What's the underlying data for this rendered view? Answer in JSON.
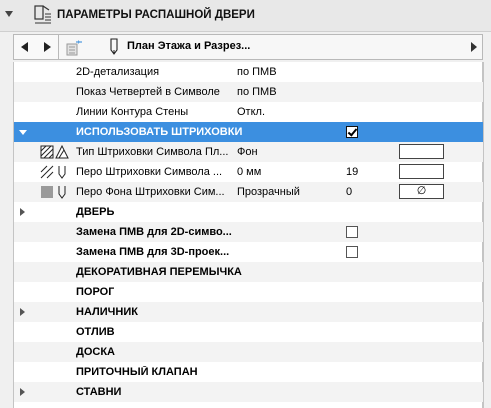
{
  "header": {
    "title": "ПАРАМЕТРЫ РАСПАШНОЙ ДВЕРИ",
    "icon": "door-settings-icon"
  },
  "toolbar": {
    "prev_icon": "arrow-left-icon",
    "next_icon": "arrow-right-icon",
    "doc_icon": "document-icon",
    "view_icon": "pen-icon",
    "view_label": "План Этажа и Разрез..."
  },
  "rows": [
    {
      "label": "2D-детализация",
      "value": "по ПМВ"
    },
    {
      "label": "Показ Четвертей в Символе",
      "value": "по ПМВ"
    },
    {
      "label": "Линии Контура Стены",
      "value": "Откл."
    },
    {
      "label": "ИСПОЛЬЗОВАТЬ ШТРИХОВКИ",
      "checked": true
    },
    {
      "label": "Тип Штриховки Символа Пл...",
      "value": "Фон"
    },
    {
      "label": "Перо Штриховки Символа ...",
      "value": "0 мм",
      "number": "19"
    },
    {
      "label": "Перо Фона Штриховки Сим...",
      "value": "Прозрачный",
      "number": "0",
      "swatch_symbol": "∅"
    },
    {
      "label": "ДВЕРЬ"
    },
    {
      "label": "Замена ПМВ для 2D-симво...",
      "checked": false
    },
    {
      "label": "Замена ПМВ для 3D-проек...",
      "checked": false
    },
    {
      "label": "ДЕКОРАТИВНАЯ ПЕРЕМЫЧКА"
    },
    {
      "label": "ПОРОГ"
    },
    {
      "label": "НАЛИЧНИК"
    },
    {
      "label": "ОТЛИВ"
    },
    {
      "label": "ДОСКА"
    },
    {
      "label": "ПРИТОЧНЫЙ КЛАПАН"
    },
    {
      "label": "СТАВНИ"
    }
  ],
  "colors": {
    "selection": "#3c8fe0",
    "panel": "#ffffff",
    "background": "#f0f0f0"
  }
}
